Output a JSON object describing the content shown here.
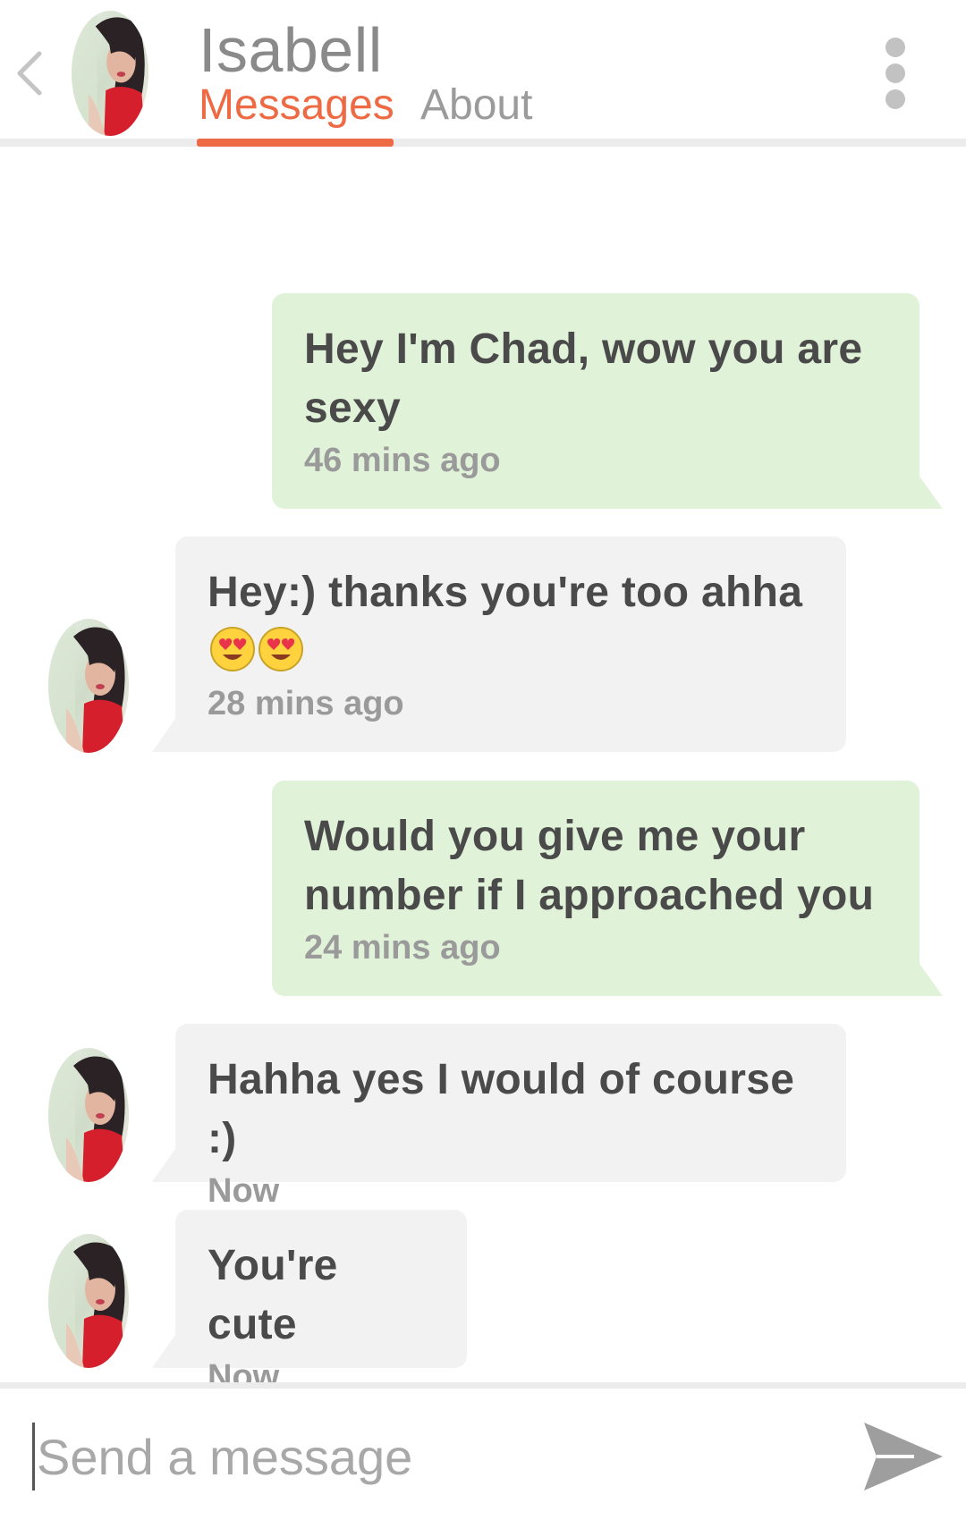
{
  "header": {
    "contact_name": "Isabell",
    "tabs": [
      {
        "label": "Messages",
        "active": true
      },
      {
        "label": "About",
        "active": false
      }
    ],
    "back_icon": "chevron-left-icon",
    "menu_icon": "more-vertical-icon"
  },
  "messages": [
    {
      "direction": "sent",
      "text": "Hey I'm Chad,  wow you are sexy",
      "time": "46 mins ago"
    },
    {
      "direction": "received",
      "text": "Hey:) thanks you're too ahha",
      "emoji": [
        "heart-eyes-emoji",
        "heart-eyes-emoji"
      ],
      "time": "28 mins ago"
    },
    {
      "direction": "sent",
      "text": "Would you give me your number if I approached you",
      "time": "24 mins ago"
    },
    {
      "direction": "received",
      "text": "Hahha yes I would of course :)",
      "time": "Now"
    },
    {
      "direction": "received",
      "text": "You're cute",
      "time": "Now"
    }
  ],
  "composer": {
    "placeholder": "Send a message",
    "value": "",
    "send_icon": "send-icon"
  },
  "colors": {
    "accent": "#ee6a44",
    "sent_bubble": "#e0f2d8",
    "received_bubble": "#f2f2f2",
    "text": "#4a4a4a",
    "muted": "#9a9a9a"
  }
}
